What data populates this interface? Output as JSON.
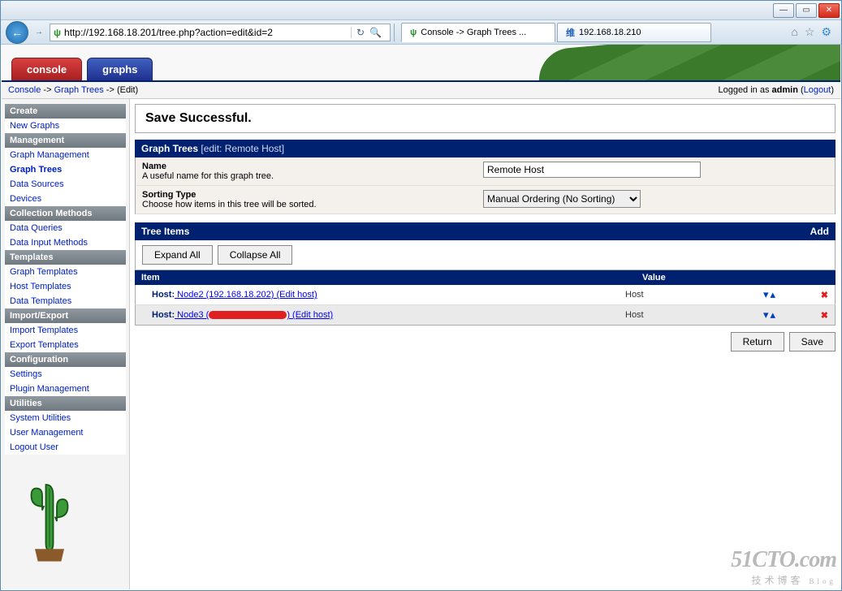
{
  "browser": {
    "url": "http://192.168.18.201/tree.php?action=edit&id=2",
    "search_icon": "🔍",
    "refresh_icon": "↻",
    "tabs": [
      {
        "icon_class": "green",
        "label": "Console -> Graph Trees ..."
      },
      {
        "icon_class": "blue",
        "label": "192.168.18.210"
      }
    ]
  },
  "app": {
    "tab_console": "console",
    "tab_graphs": "graphs"
  },
  "breadcrumb": {
    "console": "Console",
    "graph_trees": "Graph Trees",
    "edit": "(Edit)",
    "logged_in_prefix": "Logged in as ",
    "user": "admin",
    "logout": "Logout"
  },
  "sidebar": {
    "sections": {
      "create": "Create",
      "management": "Management",
      "collection": "Collection Methods",
      "templates": "Templates",
      "importexport": "Import/Export",
      "configuration": "Configuration",
      "utilities": "Utilities"
    },
    "new_graphs": "New Graphs",
    "graph_management": "Graph Management",
    "graph_trees": "Graph Trees",
    "data_sources": "Data Sources",
    "devices": "Devices",
    "data_queries": "Data Queries",
    "data_input_methods": "Data Input Methods",
    "graph_templates": "Graph Templates",
    "host_templates": "Host Templates",
    "data_templates": "Data Templates",
    "import_templates": "Import Templates",
    "export_templates": "Export Templates",
    "settings": "Settings",
    "plugin_management": "Plugin Management",
    "system_utilities": "System Utilities",
    "user_management": "User Management",
    "logout_user": "Logout User"
  },
  "main": {
    "save_success": "Save Successful.",
    "section_title": "Graph Trees",
    "section_sub": "[edit: Remote Host]",
    "name_label": "Name",
    "name_desc": "A useful name for this graph tree.",
    "name_value": "Remote Host",
    "sort_label": "Sorting Type",
    "sort_desc": "Choose how items in this tree will be sorted.",
    "sort_value": "Manual Ordering (No Sorting)",
    "tree_items": "Tree Items",
    "add": "Add",
    "expand_all": "Expand All",
    "collapse_all": "Collapse All",
    "col_item": "Item",
    "col_value": "Value",
    "rows": [
      {
        "prefix": "Host:",
        "text": " Node2 (192.168.18.202) ",
        "edit": "(Edit host)",
        "value": "Host"
      },
      {
        "prefix": "Host:",
        "text": " Node3 (",
        "redacted": true,
        "text2": ") ",
        "edit": "(Edit host)",
        "value": "Host"
      }
    ],
    "return": "Return",
    "save": "Save"
  },
  "watermark": {
    "big": "51CTO.com",
    "small": "技术博客",
    "blog": "Blog"
  }
}
